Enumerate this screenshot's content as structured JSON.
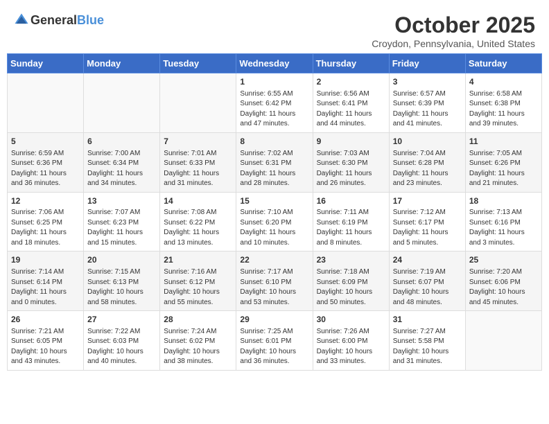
{
  "header": {
    "logo_general": "General",
    "logo_blue": "Blue",
    "title": "October 2025",
    "location": "Croydon, Pennsylvania, United States"
  },
  "days_of_week": [
    "Sunday",
    "Monday",
    "Tuesday",
    "Wednesday",
    "Thursday",
    "Friday",
    "Saturday"
  ],
  "weeks": [
    [
      {
        "day": "",
        "content": ""
      },
      {
        "day": "",
        "content": ""
      },
      {
        "day": "",
        "content": ""
      },
      {
        "day": "1",
        "content": "Sunrise: 6:55 AM\nSunset: 6:42 PM\nDaylight: 11 hours\nand 47 minutes."
      },
      {
        "day": "2",
        "content": "Sunrise: 6:56 AM\nSunset: 6:41 PM\nDaylight: 11 hours\nand 44 minutes."
      },
      {
        "day": "3",
        "content": "Sunrise: 6:57 AM\nSunset: 6:39 PM\nDaylight: 11 hours\nand 41 minutes."
      },
      {
        "day": "4",
        "content": "Sunrise: 6:58 AM\nSunset: 6:38 PM\nDaylight: 11 hours\nand 39 minutes."
      }
    ],
    [
      {
        "day": "5",
        "content": "Sunrise: 6:59 AM\nSunset: 6:36 PM\nDaylight: 11 hours\nand 36 minutes."
      },
      {
        "day": "6",
        "content": "Sunrise: 7:00 AM\nSunset: 6:34 PM\nDaylight: 11 hours\nand 34 minutes."
      },
      {
        "day": "7",
        "content": "Sunrise: 7:01 AM\nSunset: 6:33 PM\nDaylight: 11 hours\nand 31 minutes."
      },
      {
        "day": "8",
        "content": "Sunrise: 7:02 AM\nSunset: 6:31 PM\nDaylight: 11 hours\nand 28 minutes."
      },
      {
        "day": "9",
        "content": "Sunrise: 7:03 AM\nSunset: 6:30 PM\nDaylight: 11 hours\nand 26 minutes."
      },
      {
        "day": "10",
        "content": "Sunrise: 7:04 AM\nSunset: 6:28 PM\nDaylight: 11 hours\nand 23 minutes."
      },
      {
        "day": "11",
        "content": "Sunrise: 7:05 AM\nSunset: 6:26 PM\nDaylight: 11 hours\nand 21 minutes."
      }
    ],
    [
      {
        "day": "12",
        "content": "Sunrise: 7:06 AM\nSunset: 6:25 PM\nDaylight: 11 hours\nand 18 minutes."
      },
      {
        "day": "13",
        "content": "Sunrise: 7:07 AM\nSunset: 6:23 PM\nDaylight: 11 hours\nand 15 minutes."
      },
      {
        "day": "14",
        "content": "Sunrise: 7:08 AM\nSunset: 6:22 PM\nDaylight: 11 hours\nand 13 minutes."
      },
      {
        "day": "15",
        "content": "Sunrise: 7:10 AM\nSunset: 6:20 PM\nDaylight: 11 hours\nand 10 minutes."
      },
      {
        "day": "16",
        "content": "Sunrise: 7:11 AM\nSunset: 6:19 PM\nDaylight: 11 hours\nand 8 minutes."
      },
      {
        "day": "17",
        "content": "Sunrise: 7:12 AM\nSunset: 6:17 PM\nDaylight: 11 hours\nand 5 minutes."
      },
      {
        "day": "18",
        "content": "Sunrise: 7:13 AM\nSunset: 6:16 PM\nDaylight: 11 hours\nand 3 minutes."
      }
    ],
    [
      {
        "day": "19",
        "content": "Sunrise: 7:14 AM\nSunset: 6:14 PM\nDaylight: 11 hours\nand 0 minutes."
      },
      {
        "day": "20",
        "content": "Sunrise: 7:15 AM\nSunset: 6:13 PM\nDaylight: 10 hours\nand 58 minutes."
      },
      {
        "day": "21",
        "content": "Sunrise: 7:16 AM\nSunset: 6:12 PM\nDaylight: 10 hours\nand 55 minutes."
      },
      {
        "day": "22",
        "content": "Sunrise: 7:17 AM\nSunset: 6:10 PM\nDaylight: 10 hours\nand 53 minutes."
      },
      {
        "day": "23",
        "content": "Sunrise: 7:18 AM\nSunset: 6:09 PM\nDaylight: 10 hours\nand 50 minutes."
      },
      {
        "day": "24",
        "content": "Sunrise: 7:19 AM\nSunset: 6:07 PM\nDaylight: 10 hours\nand 48 minutes."
      },
      {
        "day": "25",
        "content": "Sunrise: 7:20 AM\nSunset: 6:06 PM\nDaylight: 10 hours\nand 45 minutes."
      }
    ],
    [
      {
        "day": "26",
        "content": "Sunrise: 7:21 AM\nSunset: 6:05 PM\nDaylight: 10 hours\nand 43 minutes."
      },
      {
        "day": "27",
        "content": "Sunrise: 7:22 AM\nSunset: 6:03 PM\nDaylight: 10 hours\nand 40 minutes."
      },
      {
        "day": "28",
        "content": "Sunrise: 7:24 AM\nSunset: 6:02 PM\nDaylight: 10 hours\nand 38 minutes."
      },
      {
        "day": "29",
        "content": "Sunrise: 7:25 AM\nSunset: 6:01 PM\nDaylight: 10 hours\nand 36 minutes."
      },
      {
        "day": "30",
        "content": "Sunrise: 7:26 AM\nSunset: 6:00 PM\nDaylight: 10 hours\nand 33 minutes."
      },
      {
        "day": "31",
        "content": "Sunrise: 7:27 AM\nSunset: 5:58 PM\nDaylight: 10 hours\nand 31 minutes."
      },
      {
        "day": "",
        "content": ""
      }
    ]
  ]
}
